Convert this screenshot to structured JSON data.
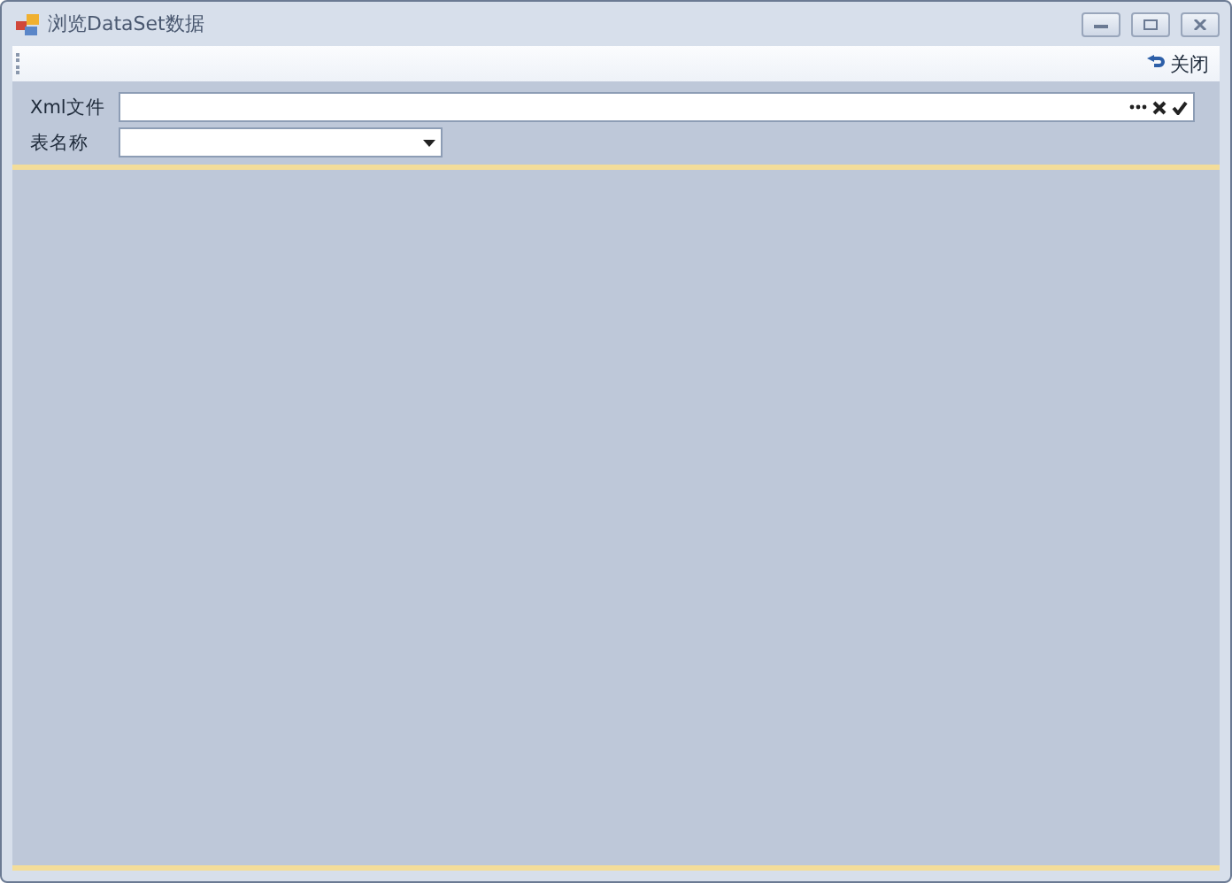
{
  "window": {
    "title": "浏览DataSet数据"
  },
  "toolbar": {
    "close_label": "关闭"
  },
  "form": {
    "xml_file": {
      "label": "Xml文件"
    },
    "table_name": {
      "label": "表名称"
    }
  }
}
